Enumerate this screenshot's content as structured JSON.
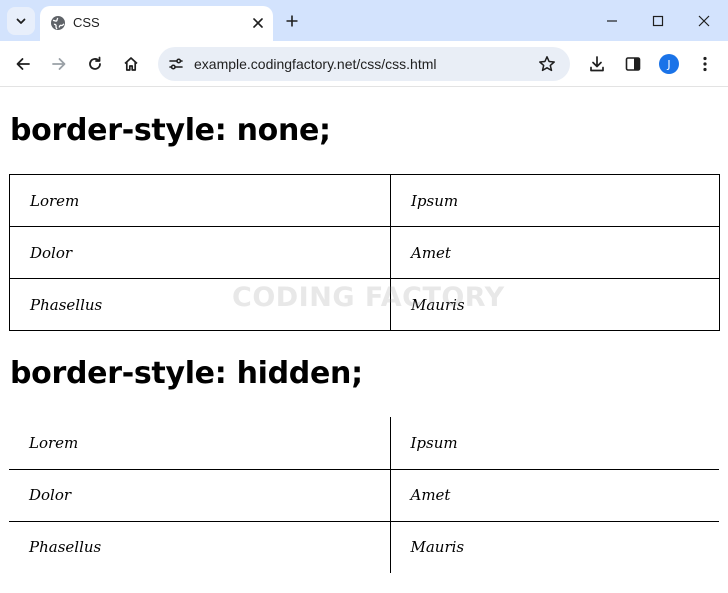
{
  "browser": {
    "tab": {
      "title": "CSS"
    },
    "url": "example.codingfactory.net/css/css.html",
    "profile_initial": "J"
  },
  "page": {
    "sections": [
      {
        "heading": "border-style: none;",
        "rows": [
          [
            "Lorem",
            "Ipsum"
          ],
          [
            "Dolor",
            "Amet"
          ],
          [
            "Phasellus",
            "Mauris"
          ]
        ]
      },
      {
        "heading": "border-style: hidden;",
        "rows": [
          [
            "Lorem",
            "Ipsum"
          ],
          [
            "Dolor",
            "Amet"
          ],
          [
            "Phasellus",
            "Mauris"
          ]
        ]
      }
    ],
    "watermark": "CODING FACTORY"
  },
  "icons": {
    "tab_search": "chevron-down-icon",
    "favicon": "globe-icon",
    "tab_close": "close-icon",
    "new_tab": "plus-icon",
    "minimize": "minimize-icon",
    "maximize": "maximize-icon",
    "close_window": "close-window-icon",
    "back": "back-arrow-icon",
    "forward": "forward-arrow-icon",
    "reload": "reload-icon",
    "home": "home-icon",
    "site_info": "tune-icon",
    "bookmark": "star-icon",
    "download": "download-icon",
    "side_panel": "side-panel-icon",
    "menu": "kebab-menu-icon"
  },
  "colors": {
    "tabstrip": "#d3e3fd",
    "omnibox": "#e9eef6",
    "avatar": "#1a73e8"
  }
}
